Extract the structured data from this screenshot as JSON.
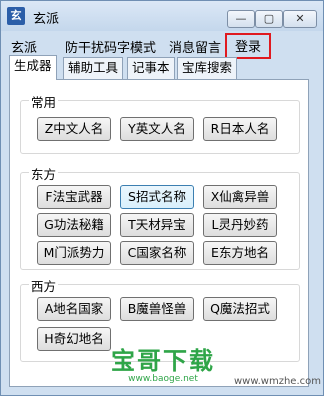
{
  "window": {
    "title": "玄派",
    "icon_letter": "玄",
    "min_glyph": "—",
    "max_glyph": "▢",
    "close_glyph": "✕"
  },
  "menu": [
    "玄派",
    "防干扰码字模式",
    "消息留言",
    "登录"
  ],
  "tabs": [
    "生成器",
    "辅助工具",
    "记事本",
    "宝库搜索"
  ],
  "groups": [
    {
      "title": "常用",
      "buttons": [
        "Z中文人名",
        "Y英文人名",
        "R日本人名"
      ]
    },
    {
      "title": "东方",
      "buttons": [
        "F法宝武器",
        "S招式名称",
        "X仙禽异兽",
        "G功法秘籍",
        "T天材异宝",
        "L灵丹妙药",
        "M门派势力",
        "C国家名称",
        "E东方地名"
      ]
    },
    {
      "title": "西方",
      "buttons": [
        "A地名国家",
        "B魔兽怪兽",
        "Q魔法招式",
        "H奇幻地名"
      ]
    }
  ],
  "watermark": {
    "main": "宝哥下载",
    "url": "www.baoge.net",
    "right": "www.wmzhe.com"
  },
  "colors": {
    "highlight_border": "#e0191f",
    "watermark_green": "#2fa548"
  }
}
